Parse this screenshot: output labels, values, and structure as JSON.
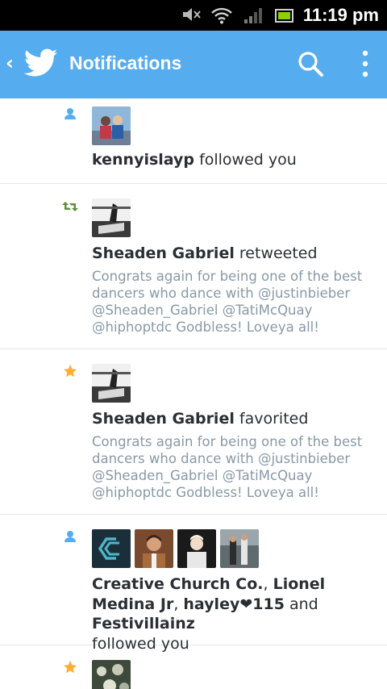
{
  "status_bar": {
    "time": "11:19 pm",
    "icons": [
      "mute-icon",
      "wifi-icon",
      "signal-icon",
      "battery-icon"
    ]
  },
  "action_bar": {
    "title": "Notifications",
    "icons": [
      "back-icon",
      "twitter-bird-icon",
      "search-icon",
      "overflow-menu-icon"
    ],
    "accent_color": "#55acee"
  },
  "notifications": [
    {
      "type_icon": "follow-person-icon",
      "actor": "kennyislayp",
      "action": "followed you"
    },
    {
      "type_icon": "retweet-icon",
      "actor": "Sheaden Gabriel",
      "action": "retweeted",
      "tweet": "Congrats again for being one of the best dancers who dance with @justinbieber @Sheaden_Gabriel @TatiMcQuay @hiphoptdc Godbless! Loveya all!"
    },
    {
      "type_icon": "favorite-star-icon",
      "actor": "Sheaden Gabriel",
      "action": "favorited",
      "tweet": "Congrats again for being one of the best dancers who dance with @justinbieber @Sheaden_Gabriel @TatiMcQuay @hiphoptdc Godbless! Loveya all!"
    },
    {
      "type_icon": "follow-person-icon",
      "actors": [
        "Creative Church Co.",
        "Lionel Medina Jr",
        "hayley❤115",
        "Festivillainz"
      ],
      "separator_1": ",",
      "separator_2": ",",
      "conjunction": "and",
      "action": "followed you"
    },
    {
      "type_icon": "favorite-star-icon"
    }
  ],
  "colors": {
    "follow": "#55acee",
    "retweet": "#5c913b",
    "favorite": "#ffac33",
    "tweet_text": "#8899a6"
  }
}
